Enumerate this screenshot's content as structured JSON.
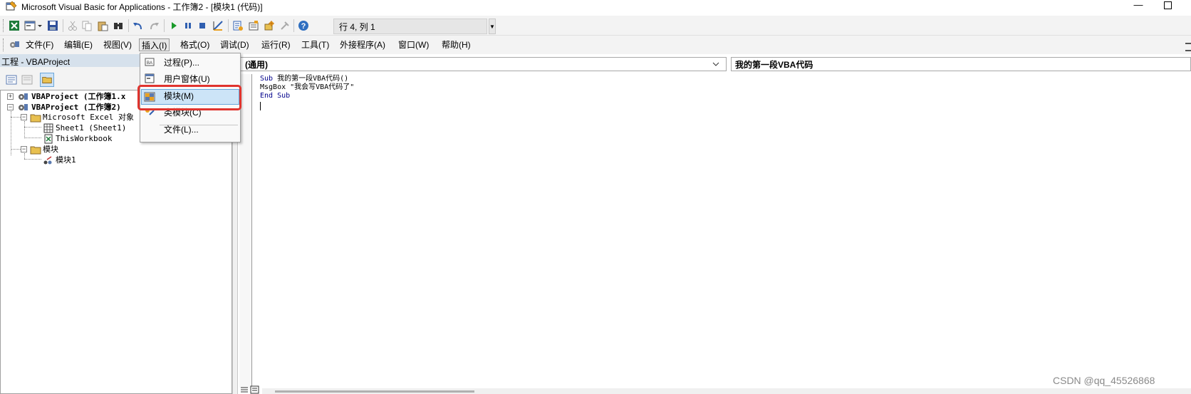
{
  "window": {
    "title": "Microsoft Visual Basic for Applications - 工作簿2 - [模块1 (代码)]",
    "minimize": "—"
  },
  "toolbar": {
    "icons": [
      "excel-icon",
      "insert-userform-icon",
      "save-icon",
      "cut-icon",
      "copy-icon",
      "paste-icon",
      "find-icon",
      "undo-icon",
      "redo-icon",
      "run-icon",
      "break-icon",
      "reset-icon",
      "design-mode-icon",
      "project-explorer-icon",
      "properties-icon",
      "object-browser-icon",
      "toolbox-icon",
      "help-icon"
    ],
    "position_label": "行 4, 列 1"
  },
  "menubar": {
    "items": [
      "文件(F)",
      "编辑(E)",
      "视图(V)",
      "插入(I)",
      "格式(O)",
      "调试(D)",
      "运行(R)",
      "工具(T)",
      "外接程序(A)",
      "窗口(W)",
      "帮助(H)"
    ],
    "active": "插入(I)"
  },
  "project_explorer": {
    "title": "工程 - VBAProject",
    "tree": [
      {
        "label": "VBAProject (工作簿1.x",
        "bold": true
      },
      {
        "label": "VBAProject (工作簿2)",
        "bold": true
      },
      {
        "label": "Microsoft Excel 对象",
        "bold": false
      },
      {
        "label": "Sheet1 (Sheet1)",
        "bold": false
      },
      {
        "label": "ThisWorkbook",
        "bold": false
      },
      {
        "label": "模块",
        "bold": false
      },
      {
        "label": "模块1",
        "bold": false
      }
    ]
  },
  "insert_menu": {
    "items": [
      "过程(P)...",
      "用户窗体(U)",
      "模块(M)",
      "类模块(C)",
      "文件(L)..."
    ],
    "highlighted": "模块(M)"
  },
  "code_window": {
    "object_combo": "(通用)",
    "procedure_combo": "我的第一段VBA代码",
    "lines": [
      {
        "kw1": "Sub",
        "text": " 我的第一段VBA代码()"
      },
      {
        "kw1": "",
        "text": "MsgBox \"我会写VBA代码了\""
      },
      {
        "kw1": "End Sub",
        "text": ""
      }
    ]
  },
  "watermark": "CSDN @qq_45526868",
  "colors": {
    "highlight_border": "#e0342e",
    "menu_highlight": "#cce4f7",
    "keyword": "#00008b",
    "explorer_header": "#d6e1ec"
  }
}
